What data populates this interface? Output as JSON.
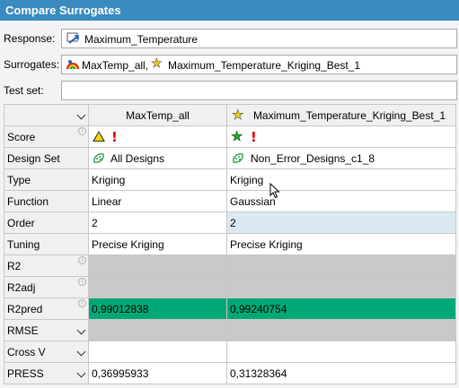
{
  "window": {
    "title": "Compare Surrogates"
  },
  "form": {
    "response_label": "Response:",
    "response_value": "Maximum_Temperature",
    "surrogates_label": "Surrogates:",
    "surrogate_1": "MaxTemp_all,",
    "surrogate_2": "Maximum_Temperature_Kriging_Best_1",
    "testset_label": "Test set:",
    "testset_value": ""
  },
  "grid": {
    "columns": [
      "MaxTemp_all",
      "Maximum_Temperature_Kriging_Best_1"
    ],
    "rows": [
      {
        "label": "Score",
        "c1": "",
        "c2": ""
      },
      {
        "label": "Design Set",
        "c1": "All Designs",
        "c2": "Non_Error_Designs_c1_8"
      },
      {
        "label": "Type",
        "c1": "Kriging",
        "c2": "Kriging"
      },
      {
        "label": "Function",
        "c1": "Linear",
        "c2": "Gaussian"
      },
      {
        "label": "Order",
        "c1": "2",
        "c2": "2"
      },
      {
        "label": "Tuning",
        "c1": "Precise Kriging",
        "c2": "Precise Kriging"
      },
      {
        "label": "R2",
        "c1": "",
        "c2": ""
      },
      {
        "label": "R2adj",
        "c1": "",
        "c2": ""
      },
      {
        "label": "R2pred",
        "c1": "0,99012838",
        "c2": "0,99240754"
      },
      {
        "label": "RMSE",
        "c1": "",
        "c2": ""
      },
      {
        "label": "Cross V",
        "c1": "",
        "c2": ""
      },
      {
        "label": "PRESS",
        "c1": "0,36995933",
        "c2": "0,31328364"
      }
    ]
  },
  "colors": {
    "title_bar": "#3a8bbf",
    "good_metric": "#00a878",
    "empty_metric": "#c9c9c9",
    "highlight": "#dbeaf1"
  },
  "icons": [
    "response-icon",
    "surrogate-rainbow-icon",
    "star-yellow-icon",
    "warning-triangle-icon",
    "exclamation-icon",
    "star-green-icon",
    "design-set-icon",
    "info-icon",
    "chevron-down-icon",
    "mouse-cursor-icon"
  ]
}
